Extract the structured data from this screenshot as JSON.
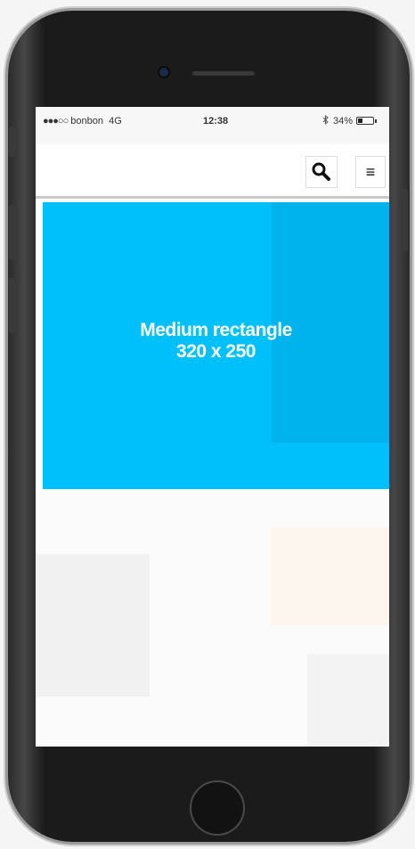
{
  "status_bar": {
    "signal_dots": "●●●○○",
    "carrier": "bonbon",
    "network": "4G",
    "time": "12:38",
    "battery_percent": "34%",
    "battery_level": 0.34,
    "bluetooth_icon": "bluetooth-icon"
  },
  "header": {
    "search_icon": "search-icon",
    "menu_icon": "hamburger-menu-icon",
    "menu_glyph": "≡"
  },
  "ad": {
    "line1": "Medium rectangle",
    "line2": "320 x 250",
    "color": "#00c0fb"
  }
}
